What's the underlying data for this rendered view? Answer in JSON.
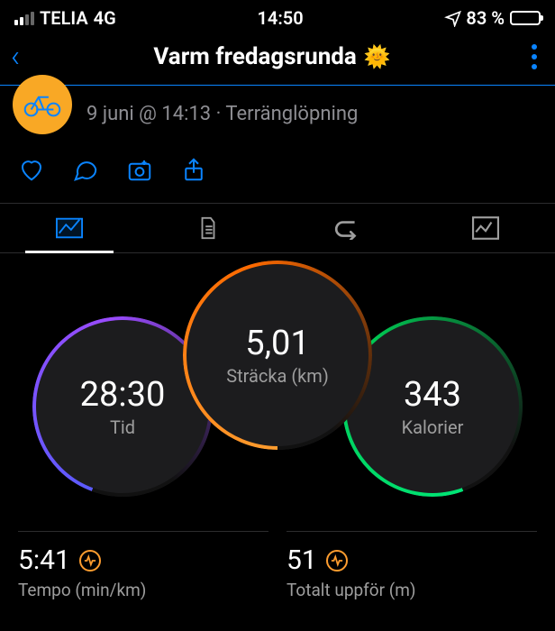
{
  "status": {
    "carrier": "TELIA",
    "network": "4G",
    "time": "14:50",
    "battery_pct": "83 %"
  },
  "header": {
    "title": "Varm fredagsrunda"
  },
  "activity": {
    "date_line": "9 juni @ 14:13 · Terränglöpning"
  },
  "rings": {
    "time": {
      "value": "28:30",
      "label": "Tid"
    },
    "distance": {
      "value": "5,01",
      "label": "Sträcka (km)"
    },
    "calories": {
      "value": "343",
      "label": "Kalorier"
    }
  },
  "stats": {
    "pace": {
      "value": "5:41",
      "label": "Tempo (min/km)"
    },
    "ascent": {
      "value": "51",
      "label": "Totalt uppför (m)"
    }
  }
}
